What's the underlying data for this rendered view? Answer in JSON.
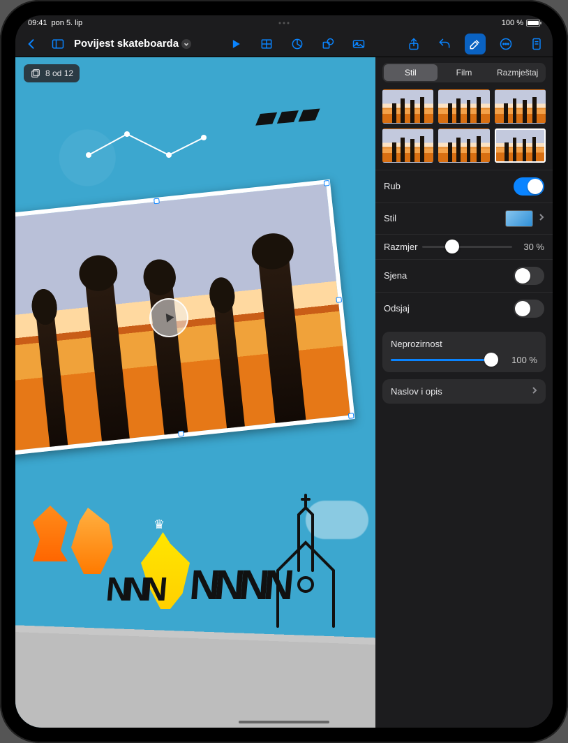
{
  "status": {
    "time": "09:41",
    "date": "pon 5. lip",
    "battery": "100 %"
  },
  "toolbar": {
    "doc_title": "Povijest skateboarda"
  },
  "slide": {
    "counter": "8 od 12"
  },
  "inspector": {
    "tabs": {
      "style": "Stil",
      "film": "Film",
      "arrange": "Razmještaj"
    },
    "border": {
      "label": "Rub",
      "on": true
    },
    "style": {
      "label": "Stil"
    },
    "scale": {
      "label": "Razmjer",
      "value": 30,
      "display": "30 %"
    },
    "shadow": {
      "label": "Sjena",
      "on": false
    },
    "reflection": {
      "label": "Odsjaj",
      "on": false
    },
    "opacity": {
      "label": "Neprozirnost",
      "value": 100,
      "display": "100 %"
    },
    "title_desc": {
      "label": "Naslov i opis"
    }
  }
}
